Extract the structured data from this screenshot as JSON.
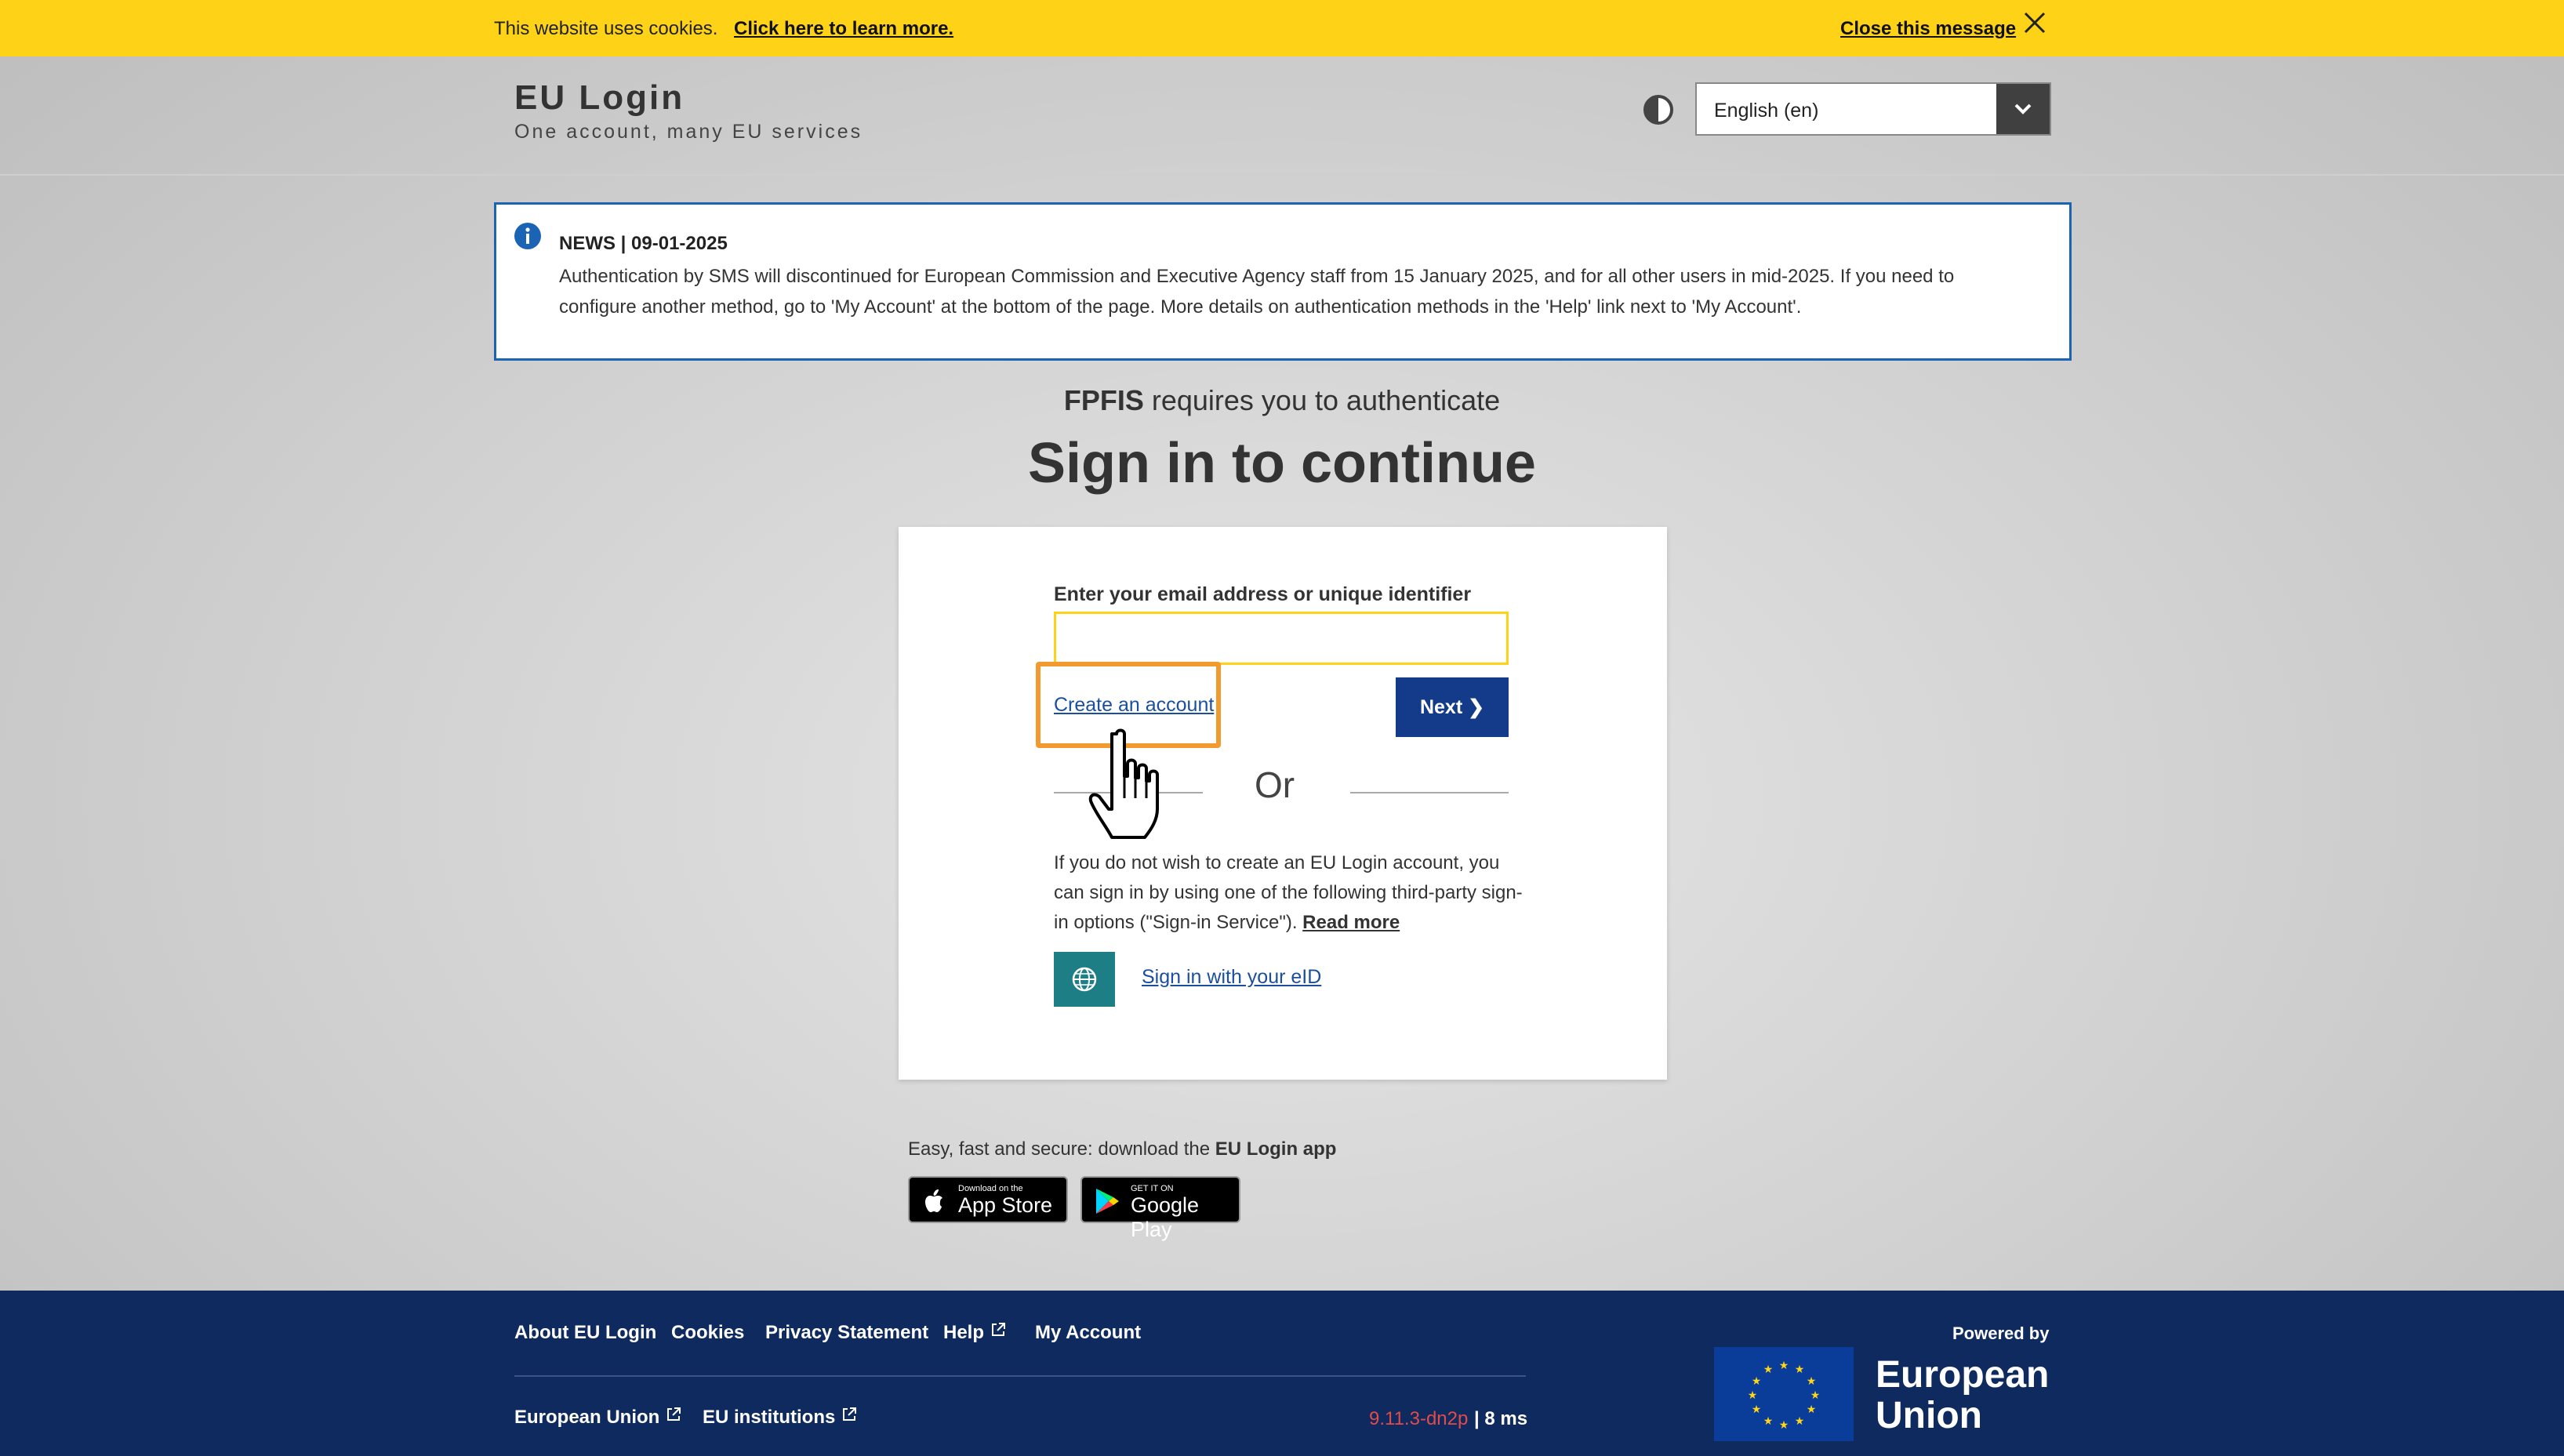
{
  "cookie_bar": {
    "message": "This website uses cookies.",
    "learn_more": "Click here to learn more.",
    "close_label": "Close this message"
  },
  "header": {
    "title": "EU Login",
    "subtitle": "One account, many EU services",
    "language": "English (en)"
  },
  "news": {
    "title": "NEWS | 09-01-2025",
    "body": "Authentication by SMS will discontinued for European Commission and Executive Agency staff from 15 January 2025, and for all other users in mid-2025. If you need to configure another method, go to 'My Account' at the bottom of the page. More details on authentication methods in the 'Help' link next to 'My Account'."
  },
  "auth": {
    "service": "FPFIS",
    "requires_text": " requires you to authenticate",
    "heading": "Sign in to continue"
  },
  "form": {
    "email_label": "Enter your email address or unique identifier",
    "email_value": "",
    "create_account": "Create an account",
    "next_button": "Next ❯",
    "or": "Or",
    "third_party_text": "If you do not wish to create an EU Login account, you can sign in by using one of the following third-party sign-in options (\"Sign-in Service\"). ",
    "read_more": "Read more",
    "eid_link": "Sign in with your eID"
  },
  "app": {
    "prefix": "Easy, fast and secure: download the ",
    "app_name": "EU Login app",
    "apple_small": "Download on the",
    "apple_big": "App Store",
    "google_small": "GET IT ON",
    "google_big": "Google Play"
  },
  "footer": {
    "links": [
      "About EU Login",
      "Cookies",
      "Privacy Statement",
      "Help",
      "My Account"
    ],
    "bottom_links": [
      "European Union",
      "EU institutions"
    ],
    "version": "9.11.3-dn2p",
    "timing": "| 8 ms",
    "powered_by": "Powered by",
    "eu_line1": "European",
    "eu_line2": "Union"
  },
  "colors": {
    "cookie_bar": "#fed317",
    "news_border": "#1b63b4",
    "next_button": "#143b8a",
    "highlight": "#f39a2f",
    "eid_button": "#1d7e85",
    "footer": "#0e2a5e"
  },
  "icons": [
    "close-icon",
    "contrast-icon",
    "chevron-down-icon",
    "info-icon",
    "globe-icon",
    "hand-pointer-icon",
    "apple-icon",
    "google-play-icon",
    "external-link-icon",
    "eu-flag-icon"
  ]
}
